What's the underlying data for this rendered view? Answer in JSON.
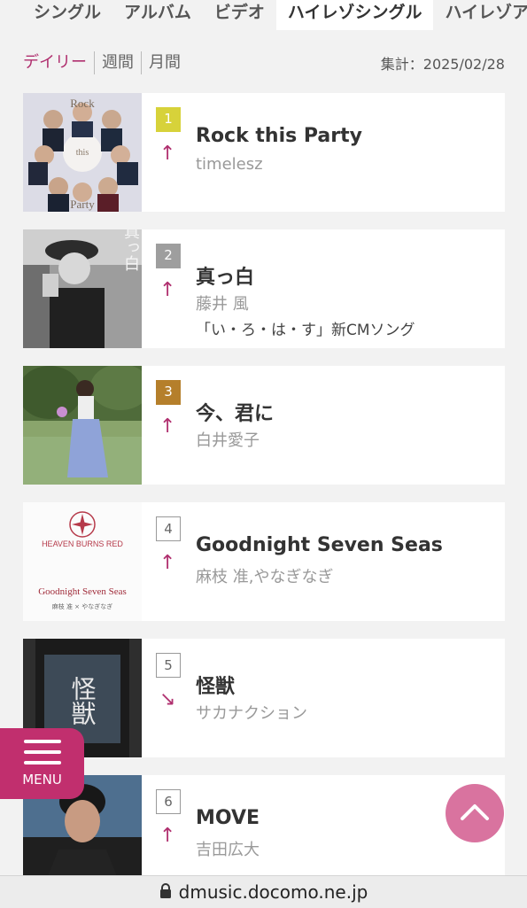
{
  "tabs": [
    {
      "label": "シングル"
    },
    {
      "label": "アルバム"
    },
    {
      "label": "ビデオ"
    },
    {
      "label": "ハイレゾシングル",
      "active": true
    },
    {
      "label": "ハイレゾア"
    }
  ],
  "periods": [
    {
      "label": "デイリー",
      "active": true
    },
    {
      "label": "週間"
    },
    {
      "label": "月間"
    }
  ],
  "aggregation": "集計：2025/02/28",
  "ranking": [
    {
      "rank": "1",
      "trend": "↑",
      "title": "Rock this Party",
      "artist": "timelesz"
    },
    {
      "rank": "2",
      "trend": "↑",
      "title": "真っ白",
      "artist": "藤井 風",
      "note": "「い・ろ・は・す」新CMソング"
    },
    {
      "rank": "3",
      "trend": "↑",
      "title": "今、君に",
      "artist": "白井愛子"
    },
    {
      "rank": "4",
      "trend": "↑",
      "title": "Goodnight Seven Seas",
      "artist": "麻枝 准,やなぎなぎ"
    },
    {
      "rank": "5",
      "trend": "↘",
      "title": "怪獣",
      "artist": "サカナクション"
    },
    {
      "rank": "6",
      "trend": "↑",
      "title": "MOVE",
      "artist": "吉田広大"
    }
  ],
  "covers": {
    "c1": {
      "text_top": "Rock",
      "text_mid": "this",
      "text_bottom": "Party"
    },
    "c2": {
      "text": "真っ白"
    },
    "c4": {
      "text_brand": "HEAVEN BURNS RED",
      "text_title": "Goodnight Seven Seas",
      "text_credit": "麻枝 准 × やなぎなぎ"
    },
    "c5": {
      "text": "怪獣"
    }
  },
  "menu": {
    "label": "MENU"
  },
  "url": "dmusic.docomo.ne.jp",
  "colors": {
    "accent": "#b0306f",
    "menu_bg": "#c12f6e",
    "to_top": "#d9739f"
  }
}
